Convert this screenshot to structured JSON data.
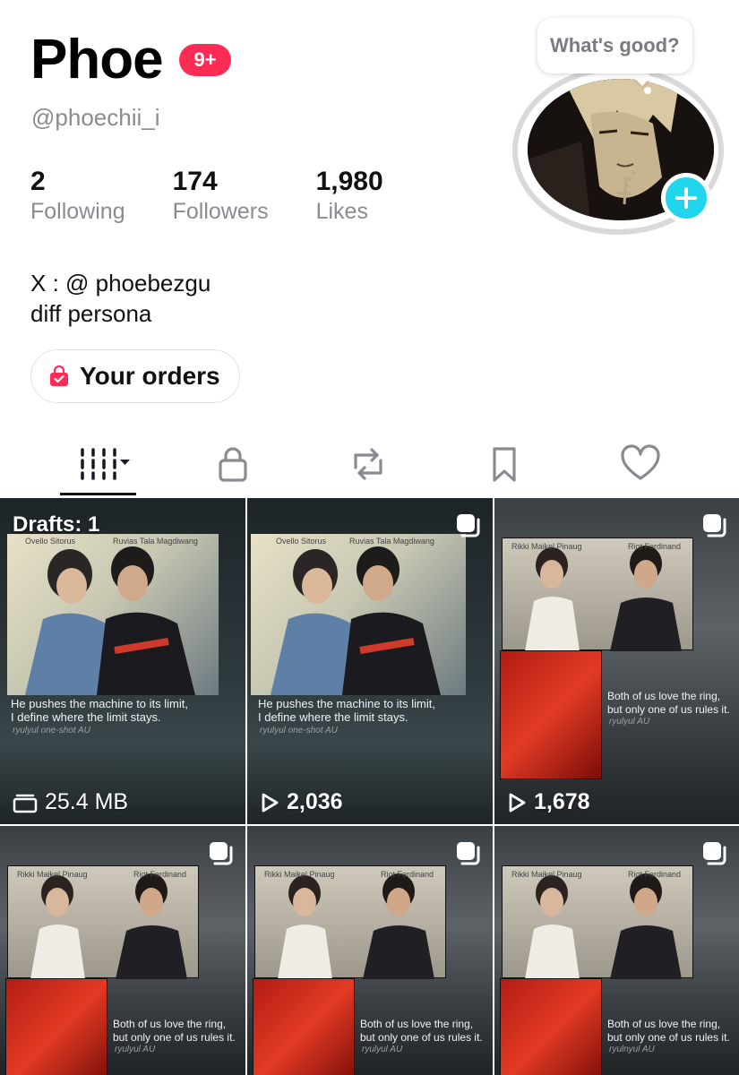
{
  "profile": {
    "display_name": "Phoe",
    "notification_badge": "9+",
    "username": "@phoechii_i",
    "note_bubble": "What's good?",
    "stats": [
      {
        "value": "2",
        "label": "Following"
      },
      {
        "value": "174",
        "label": "Followers"
      },
      {
        "value": "1,980",
        "label": "Likes"
      }
    ],
    "bio_lines": [
      "X : @ phoebezgu",
      "diff persona"
    ],
    "orders_label": "Your orders"
  },
  "tabs": [
    {
      "icon": "grid-icon",
      "active": true
    },
    {
      "icon": "lock-icon",
      "active": false
    },
    {
      "icon": "repost-icon",
      "active": false
    },
    {
      "icon": "bookmark-icon",
      "active": false
    },
    {
      "icon": "heart-icon",
      "active": false
    }
  ],
  "videos": [
    {
      "overlay": "Drafts: 1",
      "count": "25.4 MB",
      "count_icon": "storage-icon",
      "caption": [
        "He pushes the machine to its limit,",
        "I define where the limit stays."
      ],
      "credit": "ryulyul one-shot AU",
      "names": [
        "Ovello Sitorus",
        "Ruvias Tala  Magdiwang"
      ]
    },
    {
      "count": "2,036",
      "count_icon": "play-icon",
      "caption": [
        "He pushes the machine to its limit,",
        "I define where the limit stays."
      ],
      "credit": "ryulyul one-shot AU",
      "names": [
        "Ovello Sitorus",
        "Ruvias Tala  Magdiwang"
      ]
    },
    {
      "count": "1,678",
      "count_icon": "play-icon",
      "caption": [
        "Both of us love the ring,",
        "but only one of us rules it."
      ],
      "credit": "ryulyul AU",
      "names": [
        "Rikki Maikel Pinaug",
        "Riot Ferdinand"
      ]
    },
    {
      "caption": [
        "Both of us love the ring,",
        "but only one of us rules it."
      ],
      "credit": "ryulyul AU",
      "names": [
        "Rikki Maikel Pinaug",
        "Riot Ferdinand"
      ]
    },
    {
      "caption": [
        "Both of us love the ring,",
        "but only one of us rules it."
      ],
      "credit": "ryulyul AU",
      "names": [
        "Rikki Maikel Pinaug",
        "Riot Ferdinand"
      ]
    },
    {
      "caption": [
        "Both of us love the ring,",
        "but only one of us rules it."
      ],
      "credit": "ryulnyul AU",
      "names": [
        "Rikki Maikel Pinaug",
        "Riot Ferdinand"
      ]
    }
  ],
  "colors": {
    "badge": "#fe2c55",
    "add_button": "#20d5ec",
    "muted_text": "#8a8b91"
  }
}
